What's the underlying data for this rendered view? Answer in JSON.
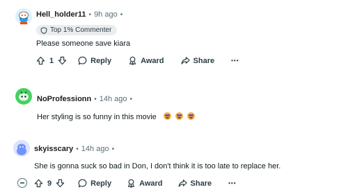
{
  "comments": [
    {
      "username": "Hell_holder11",
      "time": "9h ago",
      "separator": "•",
      "flair": "Top 1% Commenter",
      "text": "Please someone save kiara",
      "votes": "1",
      "reply_label": "Reply",
      "award_label": "Award",
      "share_label": "Share",
      "more_label": "•••",
      "avatar_color": "#24a0ed"
    },
    {
      "username": "NoProfessionn",
      "time": "14h ago",
      "separator": "•",
      "text": "Her styling is so funny in this movie",
      "emoji_count": 3,
      "avatar_color": "#46d160"
    },
    {
      "username": "skyisscary",
      "time": "14h ago",
      "separator": "•",
      "text": "She is gonna suck so bad in Don, I don't think it is too late to replace her.",
      "votes": "9",
      "reply_label": "Reply",
      "award_label": "Award",
      "share_label": "Share",
      "more_label": "•••",
      "avatar_color": "#7193ff"
    }
  ]
}
